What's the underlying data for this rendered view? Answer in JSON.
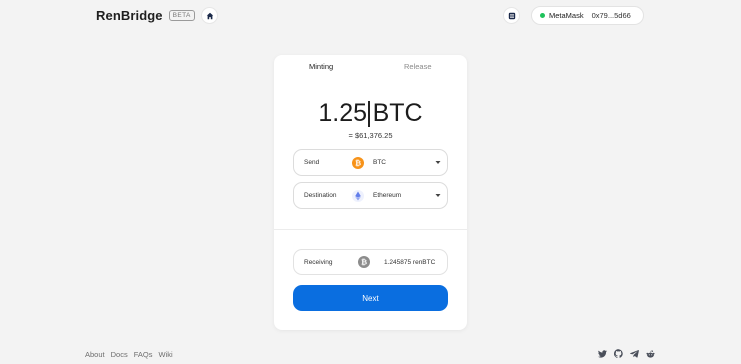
{
  "header": {
    "logo_text": "RenBridge",
    "beta_badge": "BETA",
    "wallet": {
      "name": "MetaMask",
      "address": "0x79...5d66",
      "status_color": "#1ec25b"
    }
  },
  "tabs": [
    {
      "label": "Minting",
      "active": true
    },
    {
      "label": "Release",
      "active": false
    }
  ],
  "amount": {
    "value": "1.25",
    "currency": "BTC",
    "fiat_equivalent": "= $61,376.25"
  },
  "send": {
    "label": "Send",
    "asset": "BTC",
    "icon": "bitcoin-icon"
  },
  "destination": {
    "label": "Destination",
    "chain": "Ethereum",
    "icon": "ethereum-icon"
  },
  "receiving": {
    "label": "Receiving",
    "value": "1.245875 renBTC",
    "icon": "renbtc-icon"
  },
  "next_button": {
    "label": "Next",
    "color": "#0a6ee0"
  },
  "footer": {
    "links": [
      "About",
      "Docs",
      "FAQs",
      "Wiki"
    ],
    "social_icons": [
      "twitter-icon",
      "github-icon",
      "telegram-icon",
      "reddit-icon"
    ]
  },
  "colors": {
    "bitcoin": "#f7931a",
    "ethereum": "#627eea",
    "renbtc": "#8c8c8c"
  }
}
